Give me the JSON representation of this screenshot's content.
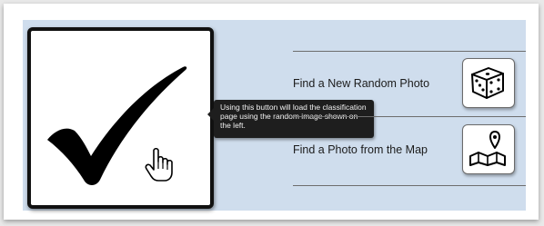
{
  "actions": {
    "random_photo_label": "Find a New Random Photo",
    "map_photo_label": "Find a Photo from the Map"
  },
  "tooltip": {
    "text": "Using this button will load the classification page using the random image shown on the left."
  },
  "icons": {
    "check": "checkmark-icon",
    "cursor": "hand-cursor-icon",
    "random": "dice-icon",
    "map": "map-pin-icon"
  },
  "colors": {
    "panel": "#cfdded",
    "tooltip_bg": "#1e1e1e",
    "checkmark": "#000000"
  }
}
